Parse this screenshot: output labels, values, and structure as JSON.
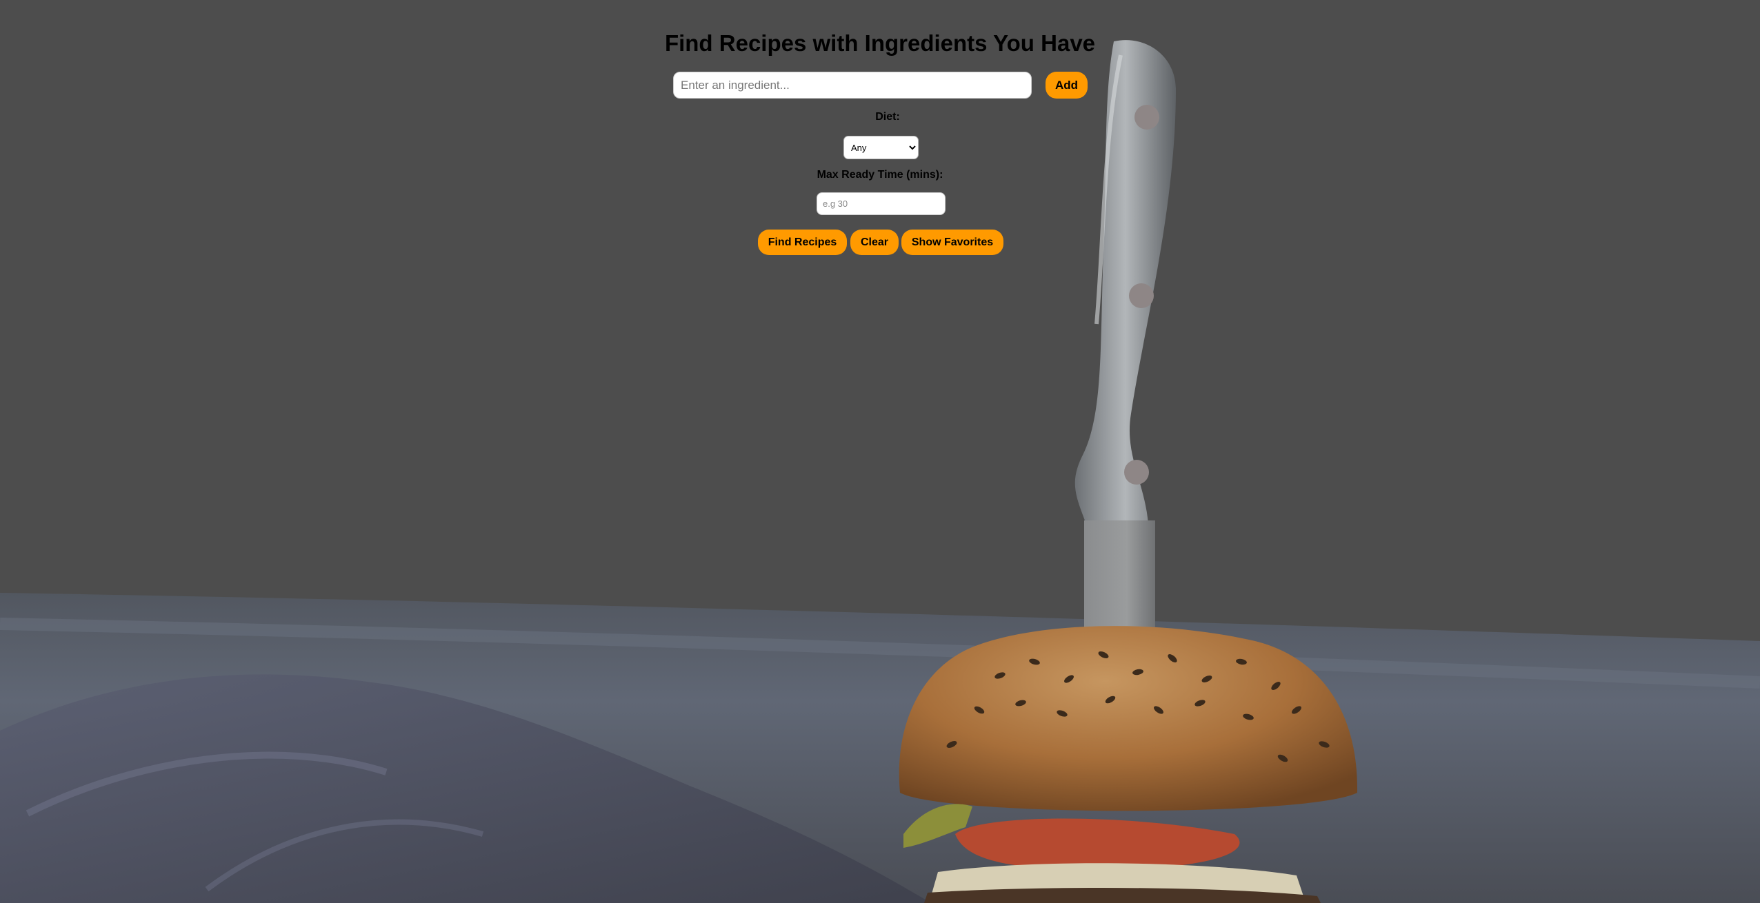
{
  "header": {
    "title": "Find Recipes with Ingredients You Have"
  },
  "ingredient": {
    "placeholder": "Enter an ingredient...",
    "value": "",
    "add_label": "Add"
  },
  "diet": {
    "label": "Diet:",
    "selected": "Any",
    "options": [
      "Any"
    ]
  },
  "ready_time": {
    "label": "Max Ready Time (mins):",
    "placeholder": "e.g 30",
    "value": ""
  },
  "actions": {
    "find_label": "Find Recipes",
    "clear_label": "Clear",
    "favorites_label": "Show Favorites"
  },
  "colors": {
    "accent": "#ff9a00",
    "overlay": "#4d4d4d"
  },
  "background": {
    "image_subject": "burger-with-knife-photo"
  }
}
